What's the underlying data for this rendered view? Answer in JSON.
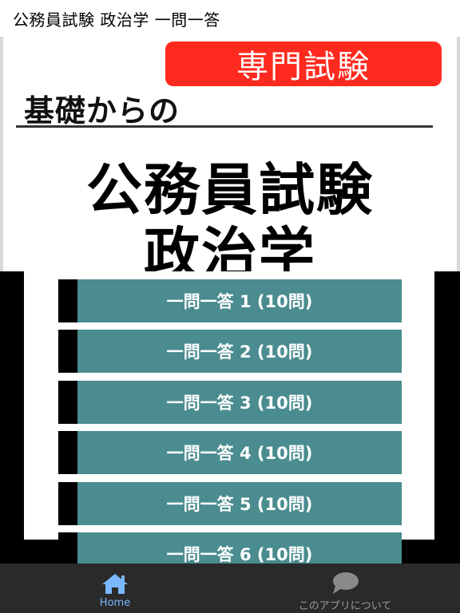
{
  "appbar": {
    "title": "公務員試験 政治学 一問一答"
  },
  "hero": {
    "badge": "専門試験",
    "subtitle": "基礎からの",
    "title_line1": "公務員試験",
    "title_line2": "政治学"
  },
  "menu": {
    "items": [
      {
        "label": "一問一答 1 (10問)"
      },
      {
        "label": "一問一答 2 (10問)"
      },
      {
        "label": "一問一答 3 (10問)"
      },
      {
        "label": "一問一答 4 (10問)"
      },
      {
        "label": "一問一答 5 (10問)"
      },
      {
        "label": "一問一答 6 (10問)"
      }
    ]
  },
  "tabbar": {
    "home": {
      "label": "Home",
      "icon": "home-icon"
    },
    "about": {
      "label": "このアプリについて",
      "icon": "speech-bubble-icon"
    }
  },
  "colors": {
    "badge": "#ff2a1f",
    "menu_button": "#4a8c8f",
    "active_tab": "#7ab8ff",
    "tabbar": "#2a2a2a"
  }
}
